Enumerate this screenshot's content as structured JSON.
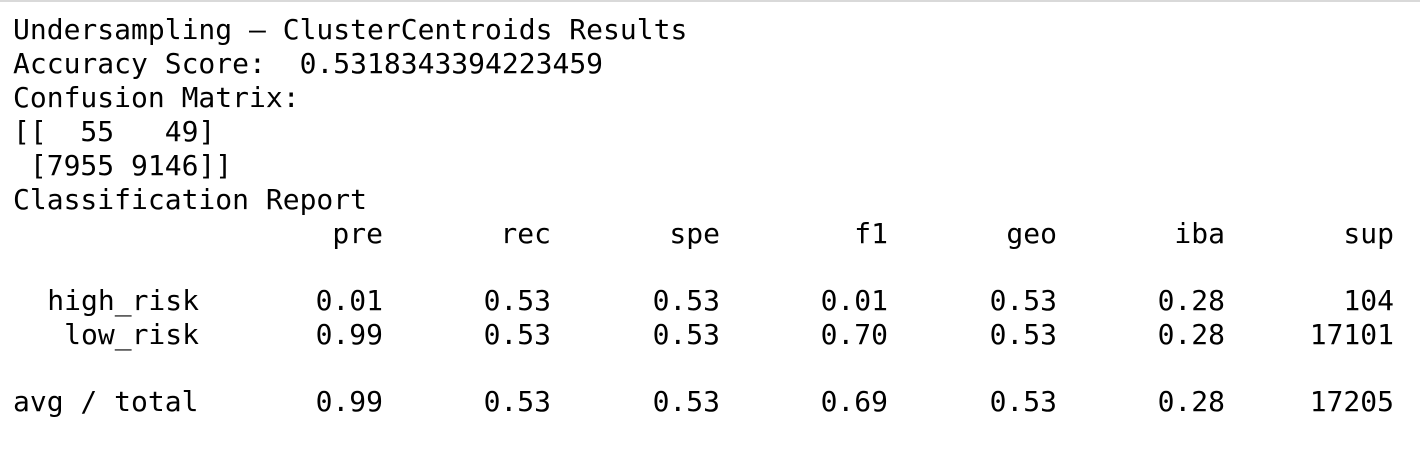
{
  "output": {
    "title": "Undersampling – ClusterCentroids Results",
    "accuracy_label": "Accuracy Score:",
    "accuracy_value": "0.5318343394223459",
    "confusion_label": "Confusion Matrix:",
    "confusion_rows": [
      "[[  55   49]",
      " [7955 9146]]"
    ],
    "report_label": "Classification Report"
  },
  "report": {
    "headers": [
      "pre",
      "rec",
      "spe",
      "f1",
      "geo",
      "iba",
      "sup"
    ],
    "rows": [
      {
        "label": "high_risk",
        "values": [
          "0.01",
          "0.53",
          "0.53",
          "0.01",
          "0.53",
          "0.28",
          "104"
        ]
      },
      {
        "label": "low_risk",
        "values": [
          "0.99",
          "0.53",
          "0.53",
          "0.70",
          "0.53",
          "0.28",
          "17101"
        ]
      }
    ],
    "total": {
      "label": "avg / total",
      "values": [
        "0.99",
        "0.53",
        "0.53",
        "0.69",
        "0.53",
        "0.28",
        "17205"
      ]
    }
  }
}
